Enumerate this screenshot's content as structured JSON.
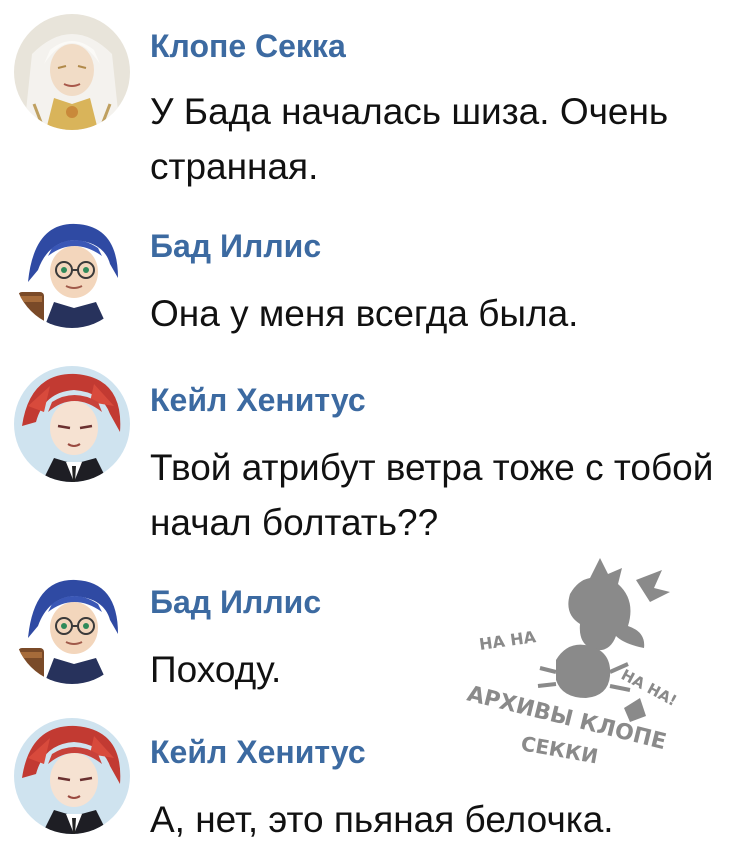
{
  "messages": [
    {
      "author": "Клопе Секка",
      "text": "У Бада началась шиза. Очень странная.",
      "avatar": "klope-avatar"
    },
    {
      "author": "Бад Иллис",
      "text": "Она у меня всегда была.",
      "avatar": "bad-avatar"
    },
    {
      "author": "Кейл Хенитус",
      "text": "Твой атрибут ветра тоже с тобой начал болтать??",
      "avatar": "cale-avatar"
    },
    {
      "author": "Бад Иллис",
      "text": "Походу.",
      "avatar": "bad-avatar"
    },
    {
      "author": "Кейл Хенитус",
      "text": "А, нет, это пьяная белочка.",
      "avatar": "cale-avatar"
    }
  ],
  "watermark": {
    "line1": "АРХИВЫ КЛОПЕ",
    "line2": "СЕККИ",
    "laugh1": "НА НА",
    "laugh2": "НА НА!"
  },
  "colors": {
    "author": "#3c6aa1",
    "text": "#111111",
    "watermark": "#8a8a8a"
  }
}
